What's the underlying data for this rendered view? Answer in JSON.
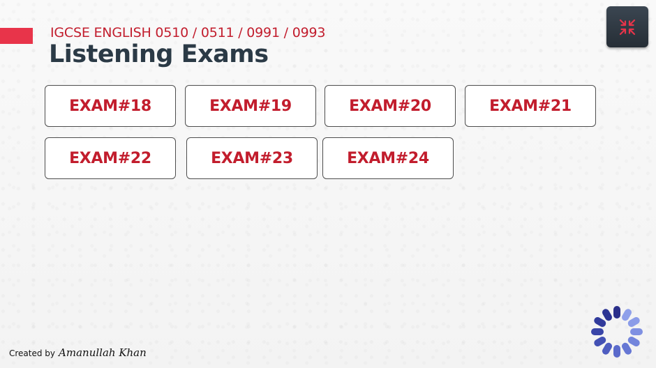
{
  "header": {
    "subtitle": "IGCSE ENGLISH 0510 / 0511 / 0991 / 0993",
    "title": "Listening Exams"
  },
  "exams": [
    {
      "label": "EXAM#18"
    },
    {
      "label": "EXAM#19"
    },
    {
      "label": "EXAM#20"
    },
    {
      "label": "EXAM#21"
    },
    {
      "label": "EXAM#22"
    },
    {
      "label": "EXAM#23"
    },
    {
      "label": "EXAM#24"
    }
  ],
  "toolbar": {
    "fullscreen_icon": "collapse-arrows-icon"
  },
  "footer": {
    "credit_prefix": "Created by",
    "credit_name": "Amanullah Khan"
  },
  "loader": {
    "icon": "loading-spinner-icon"
  },
  "colors": {
    "accent": "#e8344a",
    "exam_text": "#c21d2d",
    "title": "#2b3a46",
    "button_dark": "#2f3942",
    "spinner_dark": "#2a2f8a",
    "spinner_light": "#8fa0ea"
  }
}
